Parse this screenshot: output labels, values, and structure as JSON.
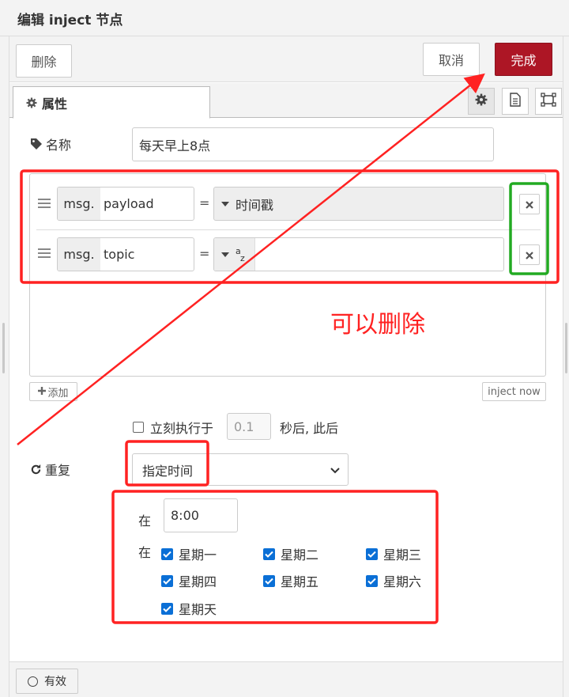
{
  "dialog": {
    "title": "编辑 inject 节点"
  },
  "toolbar": {
    "delete_label": "删除",
    "cancel_label": "取消",
    "done_label": "完成"
  },
  "tabs": {
    "properties_label": "属性"
  },
  "name": {
    "label": "名称",
    "value": "每天早上8点"
  },
  "properties": [
    {
      "prefix": "msg.",
      "key": "payload",
      "type_label": "时间戳"
    },
    {
      "prefix": "msg.",
      "key": "topic",
      "type_label": "",
      "type_icon_a": "a",
      "type_icon_z": "z"
    }
  ],
  "buttons": {
    "add_label": "添加",
    "inject_now_label": "inject now"
  },
  "once": {
    "label": "立刻执行于",
    "delay_placeholder": "0.1",
    "after_label": "秒后, 此后"
  },
  "repeat": {
    "label": "重复",
    "selected": "指定时间"
  },
  "schedule": {
    "at_label": "在",
    "time": "8:00",
    "days_label": "在",
    "days": [
      "星期一",
      "星期二",
      "星期三",
      "星期四",
      "星期五",
      "星期六",
      "星期天"
    ]
  },
  "footer": {
    "enabled_label": "有效"
  },
  "annotation": {
    "note": "可以删除",
    "red_color": "#ff2222",
    "green_color": "#22aa22"
  },
  "colors": {
    "primary_button": "#ad1625",
    "checkbox": "#0a6fd6"
  }
}
